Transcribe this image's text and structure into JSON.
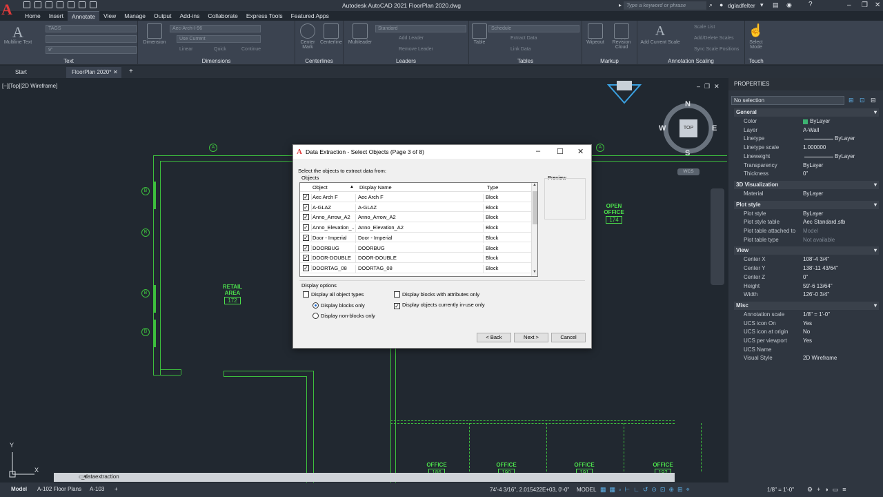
{
  "app": {
    "title": "Autodesk AutoCAD 2021   FloorPlan 2020.dwg",
    "search_placeholder": "Type a keyword or phrase",
    "user": "dgladfelter"
  },
  "menu_tabs": [
    "Home",
    "Insert",
    "Annotate",
    "View",
    "Manage",
    "Output",
    "Add-ins",
    "Collaborate",
    "Express Tools",
    "Featured Apps"
  ],
  "ribbon": {
    "text_panel": {
      "title": "Text",
      "big_label": "Multiline Text",
      "style_combo": "TAGS",
      "height_combo": "9\""
    },
    "dimensions_panel": {
      "title": "Dimensions",
      "big_label": "Dimension",
      "style_combo": "Aec-Arch-I-96",
      "layer_combo": "Use Current",
      "linear": "Linear",
      "quick": "Quick",
      "continue": "Continue"
    },
    "centerlines_panel": {
      "title": "Centerlines",
      "center_mark": "Center Mark",
      "centerline": "Centerline"
    },
    "leaders_panel": {
      "title": "Leaders",
      "big_label": "Multileader",
      "style_combo": "Standard",
      "add": "Add Leader",
      "remove": "Remove Leader"
    },
    "tables_panel": {
      "title": "Tables",
      "big_label": "Table",
      "style_combo": "Schedule",
      "extract": "Extract Data",
      "link": "Link Data"
    },
    "markup_panel": {
      "title": "Markup",
      "wipeout": "Wipeout",
      "revision": "Revision Cloud"
    },
    "annoscale_panel": {
      "title": "Annotation Scaling",
      "add_current": "Add Current Scale",
      "scale_list": "Scale List",
      "add_delete": "Add/Delete Scales",
      "sync": "Sync Scale Positions"
    },
    "touch_panel": {
      "title": "Touch",
      "select_mode": "Select Mode"
    }
  },
  "doc_tabs": [
    {
      "label": "Start"
    },
    {
      "label": "FloorPlan 2020*"
    }
  ],
  "viewport_label": "[−][Top][2D Wireframe]",
  "viewcube": {
    "n": "N",
    "s": "S",
    "e": "E",
    "w": "W",
    "top": "TOP",
    "wcs": "WCS"
  },
  "rooms": [
    {
      "name": "OPEN OFFICE",
      "num": "174"
    },
    {
      "name": "RETAIL AREA",
      "num": "172"
    },
    {
      "name": "OFFICE",
      "num": "186"
    },
    {
      "name": "OFFICE",
      "num": "190"
    },
    {
      "name": "OFFICE",
      "num": "191"
    },
    {
      "name": "OFFICE",
      "num": "192"
    }
  ],
  "grid_bubbles": {
    "a": "A",
    "b": "B"
  },
  "ucs": {
    "x": "X",
    "y": "Y"
  },
  "dialog": {
    "title": "Data Extraction - Select Objects (Page 3 of 8)",
    "instruction": "Select the objects to extract data from:",
    "objects_label": "Objects",
    "preview_label": "Preview",
    "columns": {
      "object": "Object",
      "display_name": "Display Name",
      "type": "Type"
    },
    "rows": [
      {
        "object": "Aec Arch F",
        "display_name": "Aec Arch F",
        "type": "Block",
        "checked": true
      },
      {
        "object": "A-GLAZ",
        "display_name": "A-GLAZ",
        "type": "Block",
        "checked": true
      },
      {
        "object": "Anno_Arrow_A2",
        "display_name": "Anno_Arrow_A2",
        "type": "Block",
        "checked": true
      },
      {
        "object": "Anno_Elevation_...",
        "display_name": "Anno_Elevation_A2",
        "type": "Block",
        "checked": true
      },
      {
        "object": "Door - Imperial",
        "display_name": "Door - Imperial",
        "type": "Block",
        "checked": true
      },
      {
        "object": "DOORBUG",
        "display_name": "DOORBUG",
        "type": "Block",
        "checked": true
      },
      {
        "object": "DOOR-DOUBLE",
        "display_name": "DOOR-DOUBLE",
        "type": "Block",
        "checked": true
      },
      {
        "object": "DOORTAG_08",
        "display_name": "DOORTAG_08",
        "type": "Block",
        "checked": true
      }
    ],
    "display_options_label": "Display options",
    "opt_all_types": "Display all object types",
    "opt_blocks_only": "Display blocks only",
    "opt_non_blocks": "Display non-blocks only",
    "opt_attr_only": "Display blocks with attributes only",
    "opt_in_use": "Display objects currently in-use only",
    "back": "< Back",
    "next": "Next >",
    "cancel": "Cancel"
  },
  "properties": {
    "header": "PROPERTIES",
    "selection": "No selection",
    "categories": [
      {
        "name": "General",
        "rows": [
          {
            "k": "Color",
            "v": "ByLayer"
          },
          {
            "k": "Layer",
            "v": "A-Wall"
          },
          {
            "k": "Linetype",
            "v": "ByLayer"
          },
          {
            "k": "Linetype scale",
            "v": "1.000000"
          },
          {
            "k": "Lineweight",
            "v": "ByLayer"
          },
          {
            "k": "Transparency",
            "v": "ByLayer"
          },
          {
            "k": "Thickness",
            "v": "0\""
          }
        ]
      },
      {
        "name": "3D Visualization",
        "rows": [
          {
            "k": "Material",
            "v": "ByLayer"
          }
        ]
      },
      {
        "name": "Plot style",
        "rows": [
          {
            "k": "Plot style",
            "v": "ByLayer"
          },
          {
            "k": "Plot style table",
            "v": "Aec Standard.stb"
          },
          {
            "k": "Plot table attached to",
            "v": "Model"
          },
          {
            "k": "Plot table type",
            "v": "Not available"
          }
        ]
      },
      {
        "name": "View",
        "rows": [
          {
            "k": "Center X",
            "v": "108'-4 3/4\""
          },
          {
            "k": "Center Y",
            "v": "138'-11 43/64\""
          },
          {
            "k": "Center Z",
            "v": "0\""
          },
          {
            "k": "Height",
            "v": "59'-6 13/64\""
          },
          {
            "k": "Width",
            "v": "126'-0 3/4\""
          }
        ]
      },
      {
        "name": "Misc",
        "rows": [
          {
            "k": "Annotation scale",
            "v": "1/8\" = 1'-0\""
          },
          {
            "k": "UCS icon On",
            "v": "Yes"
          },
          {
            "k": "UCS icon at origin",
            "v": "No"
          },
          {
            "k": "UCS per viewport",
            "v": "Yes"
          },
          {
            "k": "UCS Name",
            "v": ""
          },
          {
            "k": "Visual Style",
            "v": "2D Wireframe"
          }
        ]
      }
    ]
  },
  "command_line": "_dataextraction",
  "status": {
    "layout_tabs": [
      "Model",
      "A-102 Floor Plans",
      "A-103"
    ],
    "coords": "74'-4 3/16\", 2.015422E+03, 0'-0\"",
    "model": "MODEL",
    "scale": "1/8\" = 1'-0\""
  }
}
